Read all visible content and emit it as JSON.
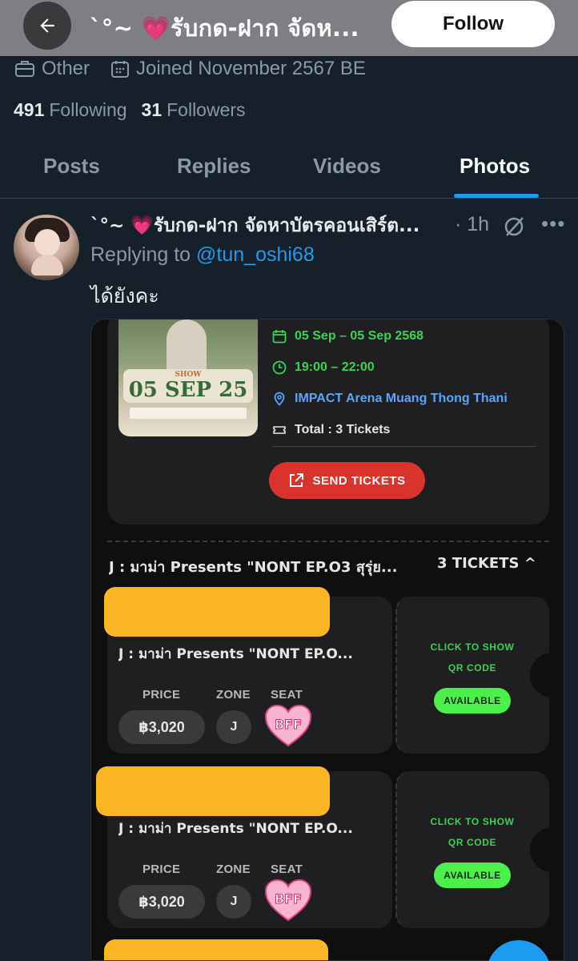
{
  "header": {
    "title": "`°~ 💗รับกด-ฝาก จัดห...",
    "follow_label": "Follow"
  },
  "profile": {
    "category": "Other",
    "joined": "Joined November 2567 BE",
    "following_count": "491",
    "following_label": "Following",
    "followers_count": "31",
    "followers_label": "Followers"
  },
  "tabs": [
    {
      "label": "Posts",
      "active": false
    },
    {
      "label": "Replies",
      "active": false
    },
    {
      "label": "Videos",
      "active": false
    },
    {
      "label": "Photos",
      "active": true
    }
  ],
  "post": {
    "author": "`°~ 💗รับกด-ฝาก จัดหาบัตรคอนเสิร์ต...",
    "time": "· 1h",
    "replying_prefix": "Replying to",
    "replying_handle": "@tun_oshi68",
    "text": "ได้ยังคะ"
  },
  "media": {
    "poster": {
      "show": "SHOW",
      "date": "05 SEP 25"
    },
    "event_date": "05 Sep – 05 Sep 2568",
    "event_time": "19:00 – 22:00",
    "venue": "IMPACT Arena Muang Thong Thani",
    "total": "Total : 3 Tickets",
    "send_label": "SEND TICKETS",
    "event_title": "J : มาม่า Presents \"NONT EP.O3 สุรุ่ย...",
    "ticket_count": "3 TICKETS ^",
    "tickets": [
      {
        "name": "J : มาม่า Presents \"NONT EP.O...",
        "price_label": "PRICE",
        "zone_label": "ZONE",
        "seat_label": "SEAT",
        "price": "฿3,020",
        "zone": "J",
        "seat": "BFF",
        "qr_line1": "CLICK TO SHOW",
        "qr_line2": "QR CODE",
        "status": "AVAILABLE"
      },
      {
        "name": "J : มาม่า Presents \"NONT EP.O...",
        "price_label": "PRICE",
        "zone_label": "ZONE",
        "seat_label": "SEAT",
        "price": "฿3,020",
        "zone": "J",
        "seat": "BFF",
        "qr_line1": "CLICK TO SHOW",
        "qr_line2": "QR CODE",
        "status": "AVAILABLE"
      }
    ]
  },
  "colors": {
    "background": "#15202b",
    "accent": "#1d9bf0",
    "ticket_green": "#39d353",
    "redaction": "#fbb626",
    "send_red": "#d9342b"
  }
}
